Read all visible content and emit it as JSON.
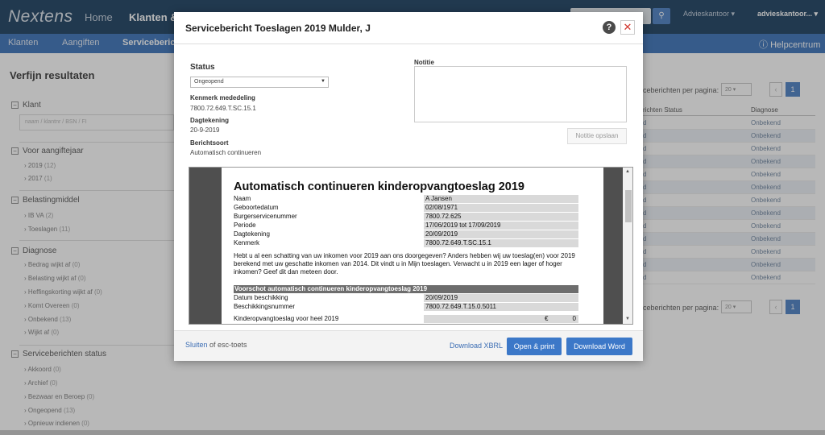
{
  "topbar": {
    "logo": "Nextens",
    "nav": [
      "Home",
      "Klanten &"
    ],
    "account_office": "Advieskantoor",
    "account_user": "advieskantoor..."
  },
  "subnav": {
    "items": [
      "Klanten",
      "Aangiften",
      "Servicebericht"
    ],
    "help": "Helpcentrum"
  },
  "filters": {
    "title": "Verfijn resultaten",
    "klant": {
      "label": "Klant",
      "placeholder": "naam / klantnr / BSN / FI"
    },
    "aangiftejaar": {
      "label": "Voor aangiftejaar",
      "items": [
        [
          "2019",
          "(12)"
        ],
        [
          "2017",
          "(1)"
        ]
      ]
    },
    "belastingmiddel": {
      "label": "Belastingmiddel",
      "items": [
        [
          "IB VA",
          "(2)"
        ],
        [
          "Toeslagen",
          "(11)"
        ]
      ]
    },
    "diagnose": {
      "label": "Diagnose",
      "items": [
        [
          "Bedrag wijkt af",
          "(0)"
        ],
        [
          "Belasting wijkt af",
          "(0)"
        ],
        [
          "Heffingskorting wijkt af",
          "(0)"
        ],
        [
          "Komt Overeen",
          "(0)"
        ],
        [
          "Onbekend",
          "(13)"
        ],
        [
          "Wijkt af",
          "(0)"
        ]
      ]
    },
    "status": {
      "label": "Serviceberichten status",
      "items": [
        [
          "Akkoord",
          "(0)"
        ],
        [
          "Archief",
          "(0)"
        ],
        [
          "Bezwaar en Beroep",
          "(0)"
        ],
        [
          "Ongeopend",
          "(13)"
        ],
        [
          "Opnieuw indienen",
          "(0)"
        ]
      ]
    }
  },
  "table": {
    "per_page_label": "ceberichten per pagina:",
    "per_page_value": "20",
    "page": "1",
    "col_status": "richten Status",
    "col_diagnose": "Diagnose",
    "row_status": "d",
    "row_diagnose": "Onbekend"
  },
  "modal": {
    "title": "Servicebericht Toeslagen 2019 Mulder, J",
    "status_label": "Status",
    "status_value": "Ongeopend",
    "kenmerk_label": "Kenmerk mededeling",
    "kenmerk_value": "7800.72.649.T.SC.15.1",
    "dagtekening_label": "Dagtekening",
    "dagtekening_value": "20-9-2019",
    "berichtsoort_label": "Berichtsoort",
    "berichtsoort_value": "Automatisch continueren",
    "notitie_label": "Notitie",
    "notitie_button": "Notitie opslaan",
    "footer_close_link": "Sluiten",
    "footer_close_rest": " of esc-toets",
    "download_xbrl": "Download XBRL",
    "open_print": "Open & print",
    "download_word": "Download Word"
  },
  "document": {
    "title": "Automatisch continueren kinderopvangtoeslag 2019",
    "rows": [
      [
        "Naam",
        "A Jansen"
      ],
      [
        "Geboortedatum",
        "02/08/1971"
      ],
      [
        "Burgerservicenummer",
        "7800.72.625"
      ],
      [
        "Periode",
        "17/06/2019 tot 17/09/2019"
      ],
      [
        "Dagtekening",
        "20/09/2019"
      ],
      [
        "Kenmerk",
        "7800.72.649.T.SC.15.1"
      ]
    ],
    "paragraph": "Hebt u al een schatting van uw inkomen voor 2019 aan ons doorgegeven? Anders hebben wij uw toeslag(en) voor 2019 berekend met uw geschatte inkomen van 2014. Dit vindt u in Mijn toeslagen. Verwacht u in 2019 een lager of hoger inkomen? Geef dit dan meteen door.",
    "section": "Voorschot automatisch continueren kinderopvangtoeslag 2019",
    "section_rows": [
      [
        "Datum beschikking",
        "20/09/2019"
      ],
      [
        "Beschikkingsnummer",
        "7800.72.649.T.15.0.5011"
      ]
    ],
    "total_label": "Kinderopvangtoeslag voor heel 2019",
    "total_currency": "€",
    "total_value": "0"
  }
}
